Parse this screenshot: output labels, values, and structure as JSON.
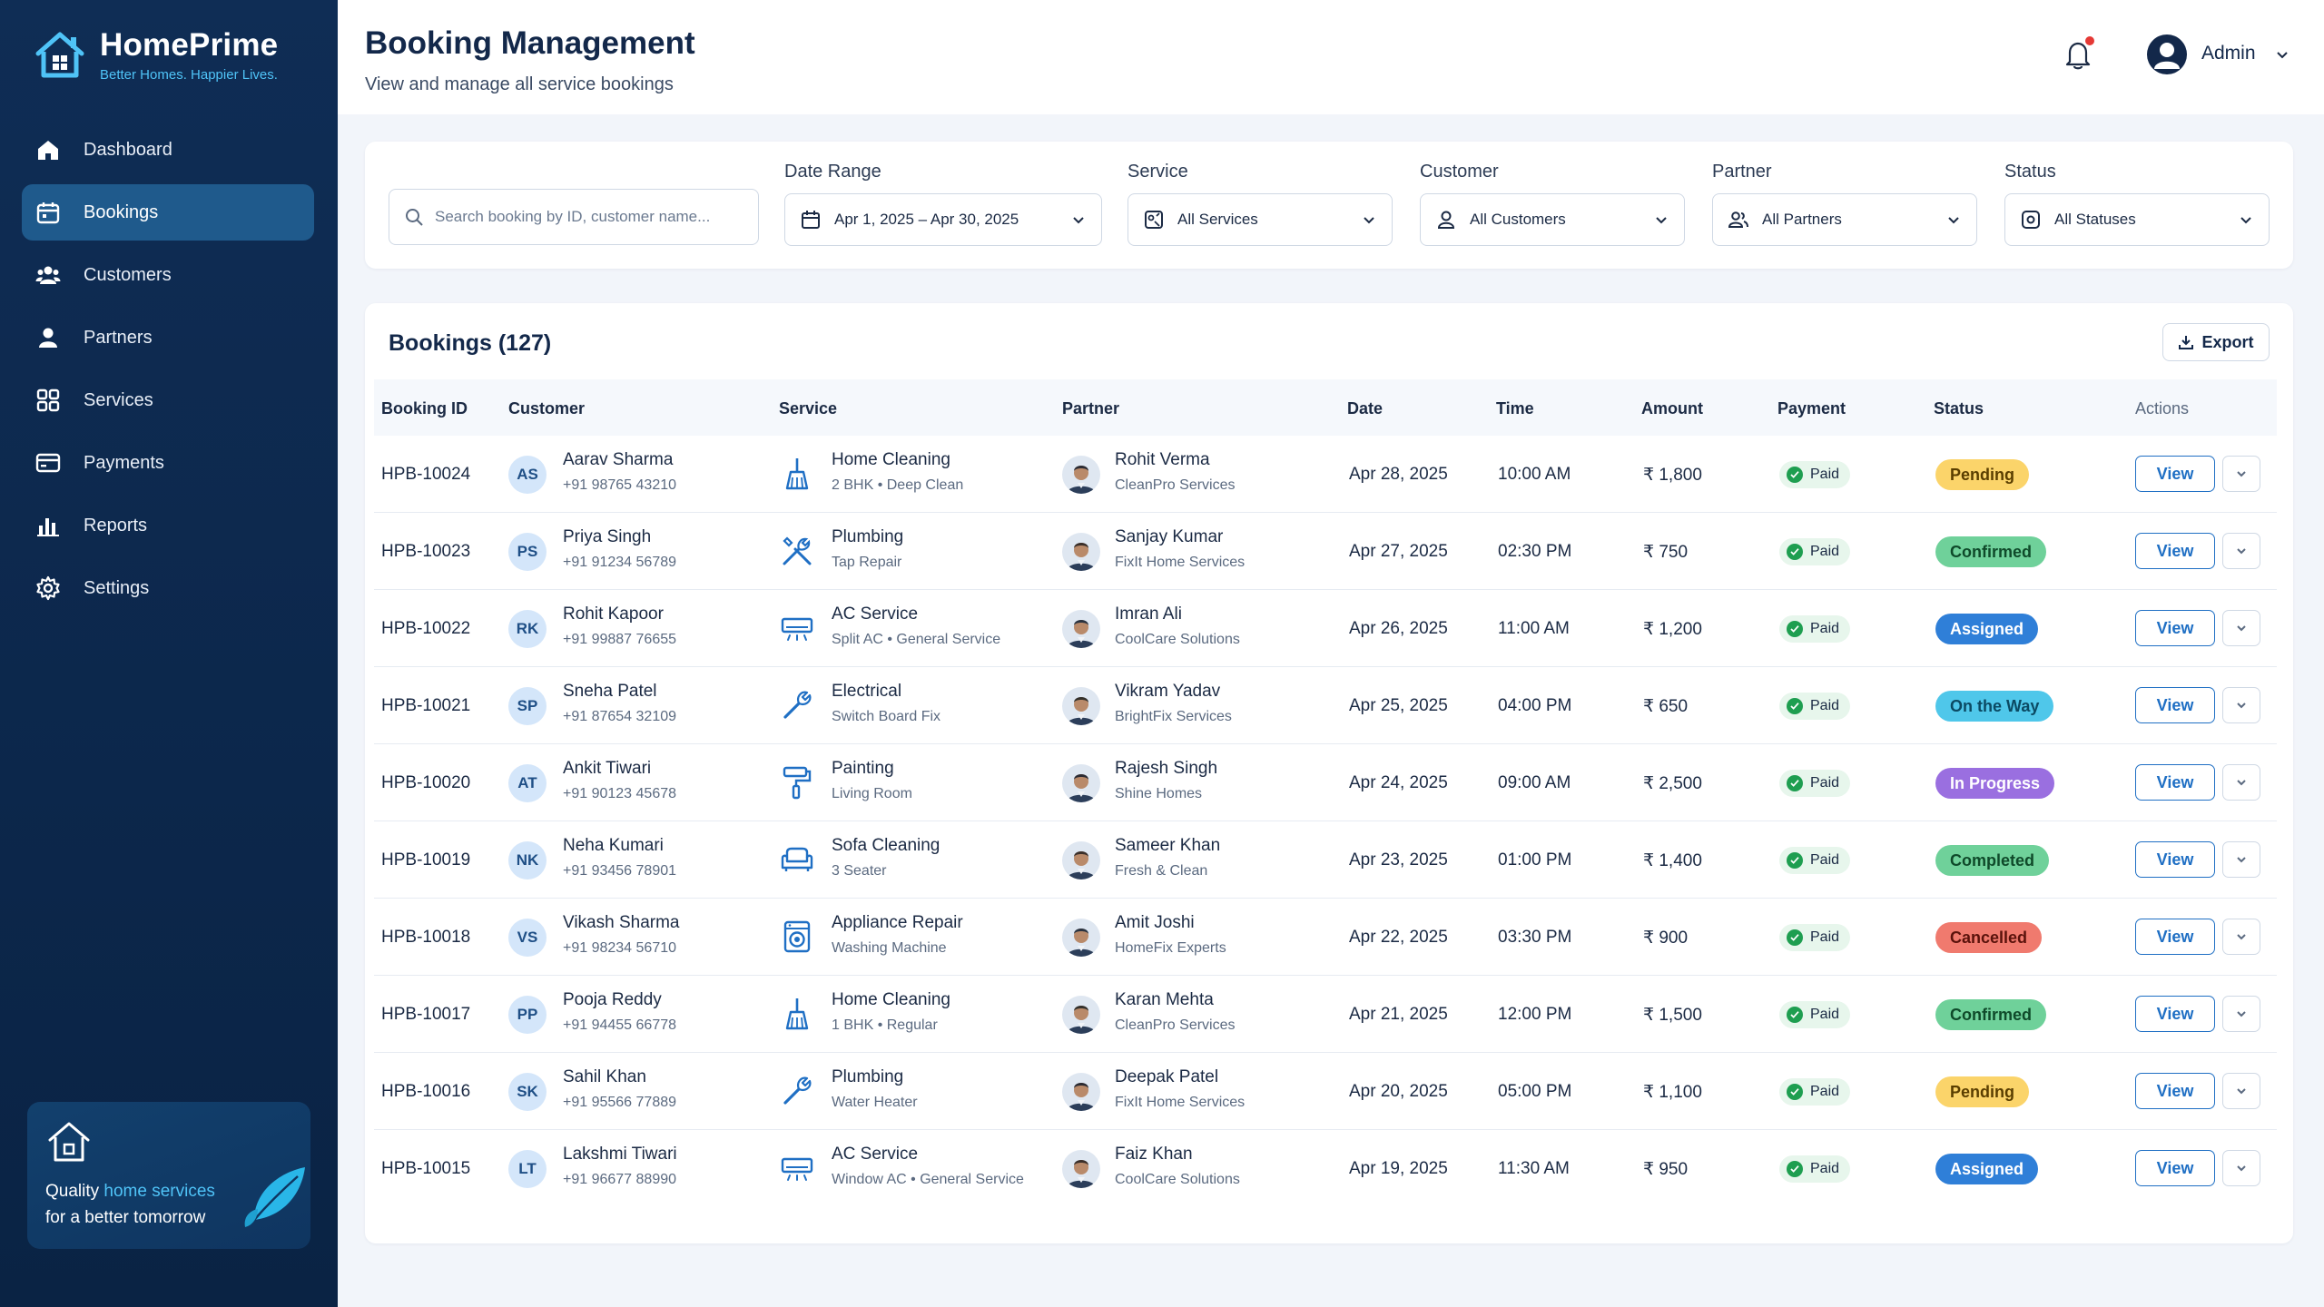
{
  "brand": {
    "name": "HomePrime",
    "tagline": "Better Homes. Happier Lives."
  },
  "sidebar": {
    "items": [
      {
        "label": "Dashboard",
        "icon": "home-icon",
        "active": false
      },
      {
        "label": "Bookings",
        "icon": "calendar-icon",
        "active": true
      },
      {
        "label": "Customers",
        "icon": "users-icon",
        "active": false
      },
      {
        "label": "Partners",
        "icon": "user-icon",
        "active": false
      },
      {
        "label": "Services",
        "icon": "grid-icon",
        "active": false
      },
      {
        "label": "Payments",
        "icon": "card-icon",
        "active": false
      },
      {
        "label": "Reports",
        "icon": "bar-chart-icon",
        "active": false
      },
      {
        "label": "Settings",
        "icon": "gear-icon",
        "active": false
      }
    ],
    "promo": {
      "line1_a": "Quality",
      "line1_b": "home services",
      "line2": "for a better tomorrow"
    }
  },
  "header": {
    "title": "Booking Management",
    "subtitle": "View and manage all service bookings",
    "user": "Admin"
  },
  "filters": {
    "search_placeholder": "Search booking by ID, customer name...",
    "date_range": {
      "label": "Date Range",
      "value": "Apr 1, 2025 – Apr 30, 2025"
    },
    "service": {
      "label": "Service",
      "value": "All Services"
    },
    "customer": {
      "label": "Customer",
      "value": "All Customers"
    },
    "partner": {
      "label": "Partner",
      "value": "All Partners"
    },
    "status": {
      "label": "Status",
      "value": "All Statuses"
    }
  },
  "table": {
    "title": "Bookings (127)",
    "export_label": "Export",
    "columns": [
      "Booking ID",
      "Customer",
      "Service",
      "Partner",
      "Date",
      "Time",
      "Amount",
      "Payment",
      "Status",
      "Actions"
    ],
    "view_label": "View",
    "status_colors": {
      "Pending": {
        "bg": "#fbd46a",
        "fg": "#5a3e00"
      },
      "Confirmed": {
        "bg": "#6fd19a",
        "fg": "#0f4a2a"
      },
      "Assigned": {
        "bg": "#2f7fd8",
        "fg": "#ffffff"
      },
      "On the Way": {
        "bg": "#4fc7ea",
        "fg": "#0b4a63"
      },
      "In Progress": {
        "bg": "#9a6fe0",
        "fg": "#ffffff"
      },
      "Completed": {
        "bg": "#6fd19a",
        "fg": "#0f4a2a"
      },
      "Cancelled": {
        "bg": "#f07a6e",
        "fg": "#5a120b"
      }
    },
    "rows": [
      {
        "id": "HPB-10024",
        "initials": "AS",
        "customer": "Aarav Sharma",
        "phone": "+91 98765 43210",
        "service": "Home Cleaning",
        "service_detail": "2 BHK • Deep Clean",
        "service_icon": "broom-icon",
        "partner": "Rohit Verma",
        "partner_company": "CleanPro Services",
        "date": "Apr 28, 2025",
        "time": "10:00 AM",
        "amount": "₹ 1,800",
        "payment": "Paid",
        "status": "Pending"
      },
      {
        "id": "HPB-10023",
        "initials": "PS",
        "customer": "Priya Singh",
        "phone": "+91 91234 56789",
        "service": "Plumbing",
        "service_detail": "Tap Repair",
        "service_icon": "tools-icon",
        "partner": "Sanjay Kumar",
        "partner_company": "FixIt Home Services",
        "date": "Apr 27, 2025",
        "time": "02:30 PM",
        "amount": "₹ 750",
        "payment": "Paid",
        "status": "Confirmed"
      },
      {
        "id": "HPB-10022",
        "initials": "RK",
        "customer": "Rohit Kapoor",
        "phone": "+91 99887 76655",
        "service": "AC Service",
        "service_detail": "Split AC • General Service",
        "service_icon": "ac-icon",
        "partner": "Imran Ali",
        "partner_company": "CoolCare Solutions",
        "date": "Apr 26, 2025",
        "time": "11:00 AM",
        "amount": "₹ 1,200",
        "payment": "Paid",
        "status": "Assigned"
      },
      {
        "id": "HPB-10021",
        "initials": "SP",
        "customer": "Sneha Patel",
        "phone": "+91 87654 32109",
        "service": "Electrical",
        "service_detail": "Switch Board Fix",
        "service_icon": "wrench-icon",
        "partner": "Vikram Yadav",
        "partner_company": "BrightFix Services",
        "date": "Apr 25, 2025",
        "time": "04:00 PM",
        "amount": "₹ 650",
        "payment": "Paid",
        "status": "On the Way"
      },
      {
        "id": "HPB-10020",
        "initials": "AT",
        "customer": "Ankit Tiwari",
        "phone": "+91 90123 45678",
        "service": "Painting",
        "service_detail": "Living Room",
        "service_icon": "paint-roller-icon",
        "partner": "Rajesh Singh",
        "partner_company": "Shine Homes",
        "date": "Apr 24, 2025",
        "time": "09:00 AM",
        "amount": "₹ 2,500",
        "payment": "Paid",
        "status": "In Progress"
      },
      {
        "id": "HPB-10019",
        "initials": "NK",
        "customer": "Neha Kumari",
        "phone": "+91 93456 78901",
        "service": "Sofa Cleaning",
        "service_detail": "3 Seater",
        "service_icon": "sofa-icon",
        "partner": "Sameer Khan",
        "partner_company": "Fresh & Clean",
        "date": "Apr 23, 2025",
        "time": "01:00 PM",
        "amount": "₹ 1,400",
        "payment": "Paid",
        "status": "Completed"
      },
      {
        "id": "HPB-10018",
        "initials": "VS",
        "customer": "Vikash Sharma",
        "phone": "+91 98234 56710",
        "service": "Appliance Repair",
        "service_detail": "Washing Machine",
        "service_icon": "washing-machine-icon",
        "partner": "Amit Joshi",
        "partner_company": "HomeFix Experts",
        "date": "Apr 22, 2025",
        "time": "03:30 PM",
        "amount": "₹ 900",
        "payment": "Paid",
        "status": "Cancelled"
      },
      {
        "id": "HPB-10017",
        "initials": "PP",
        "customer": "Pooja Reddy",
        "phone": "+91 94455 66778",
        "service": "Home Cleaning",
        "service_detail": "1 BHK • Regular",
        "service_icon": "broom-icon",
        "partner": "Karan Mehta",
        "partner_company": "CleanPro Services",
        "date": "Apr 21, 2025",
        "time": "12:00 PM",
        "amount": "₹ 1,500",
        "payment": "Paid",
        "status": "Confirmed"
      },
      {
        "id": "HPB-10016",
        "initials": "SK",
        "customer": "Sahil Khan",
        "phone": "+91 95566 77889",
        "service": "Plumbing",
        "service_detail": "Water Heater",
        "service_icon": "wrench-icon",
        "partner": "Deepak Patel",
        "partner_company": "FixIt Home Services",
        "date": "Apr 20, 2025",
        "time": "05:00 PM",
        "amount": "₹ 1,100",
        "payment": "Paid",
        "status": "Pending"
      },
      {
        "id": "HPB-10015",
        "initials": "LT",
        "customer": "Lakshmi Tiwari",
        "phone": "+91 96677 88990",
        "service": "AC Service",
        "service_detail": "Window AC • General Service",
        "service_icon": "ac-icon",
        "partner": "Faiz Khan",
        "partner_company": "CoolCare Solutions",
        "date": "Apr 19, 2025",
        "time": "11:30 AM",
        "amount": "₹ 950",
        "payment": "Paid",
        "status": "Assigned"
      }
    ]
  }
}
